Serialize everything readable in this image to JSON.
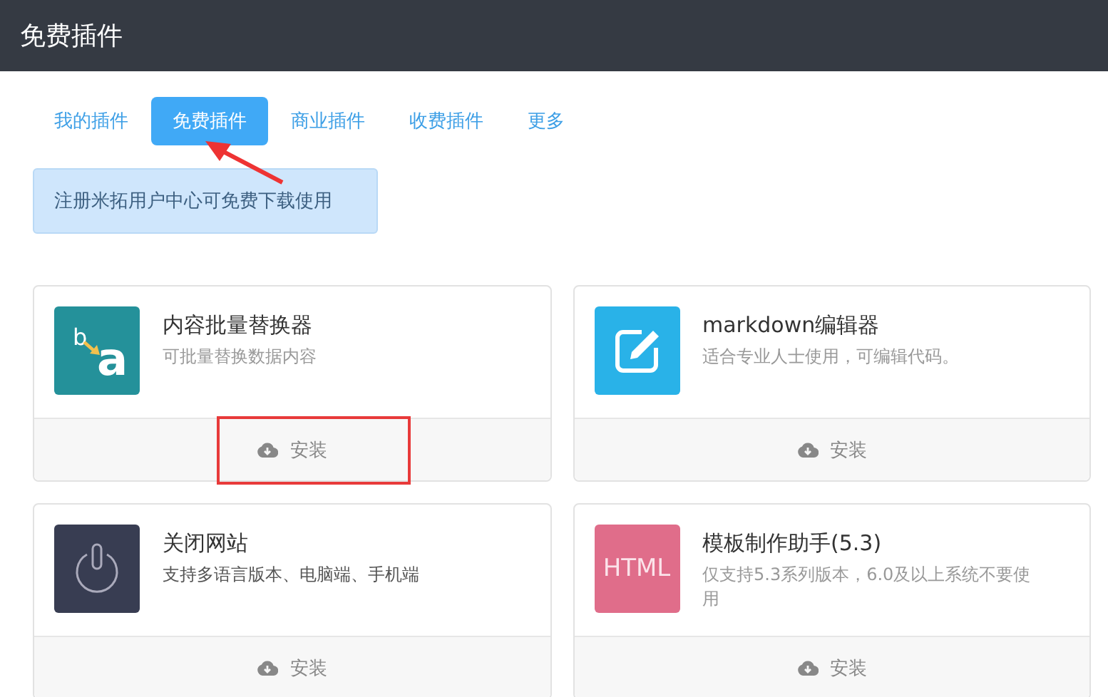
{
  "header": {
    "title": "免费插件"
  },
  "tabs": [
    {
      "label": "我的插件",
      "selected": false
    },
    {
      "label": "免费插件",
      "selected": true,
      "pointer_arrow": true
    },
    {
      "label": "商业插件",
      "selected": false
    },
    {
      "label": "收费插件",
      "selected": false
    },
    {
      "label": "更多",
      "selected": false
    }
  ],
  "notice": "注册米拓用户中心可免费下载使用",
  "plugins": [
    {
      "icon": {
        "kind": "replace",
        "color": "#24919a",
        "letters": [
          "b",
          "a"
        ]
      },
      "name": "内容批量替换器",
      "description": "可批量替换数据内容",
      "install": "安装",
      "highlighted": true
    },
    {
      "icon": {
        "kind": "edit",
        "color": "#29b2e8"
      },
      "name": "markdown编辑器",
      "description": "适合专业人士使用，可编辑代码。",
      "install": "安装",
      "highlighted": false
    },
    {
      "icon": {
        "kind": "power",
        "color": "#383d52"
      },
      "name": "关闭网站",
      "description": "支持多语言版本、电脑端、手机端",
      "install": "安装",
      "highlighted": false
    },
    {
      "icon": {
        "kind": "text",
        "color": "#e06d8a",
        "text": "HTML"
      },
      "name": "模板制作助手(5.3)",
      "description": "仅支持5.3系列版本，6.0及以上系统不要使用",
      "install": "安装",
      "highlighted": false
    }
  ]
}
